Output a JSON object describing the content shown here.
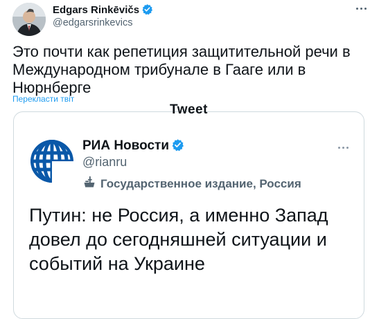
{
  "tweet": {
    "author_name": "Edgars Rinkēvičs",
    "author_handle": "@edgarsrinkevics",
    "text": "Это почти как репетиция защитительной речи в Международном трибунале в Гааге или в Нюрнберге",
    "translate_label": "Перекласти твіт",
    "watermark": "Tweet"
  },
  "quoted": {
    "author_name": "РИА Новости",
    "author_handle": "@rianru",
    "state_label": "Государственное издание, Россия",
    "text": "Путин: не Россия, а именно Запад довел до сегодняшней ситуации и событий на Украине"
  },
  "icons": {
    "verified": "verified-badge-icon",
    "more": "more-dots-icon",
    "state_media": "state-media-icon"
  },
  "colors": {
    "link": "#1d9bf0",
    "verified": "#1d9bf0",
    "secondary_text": "#536471",
    "ria_blue": "#0a58a8"
  }
}
